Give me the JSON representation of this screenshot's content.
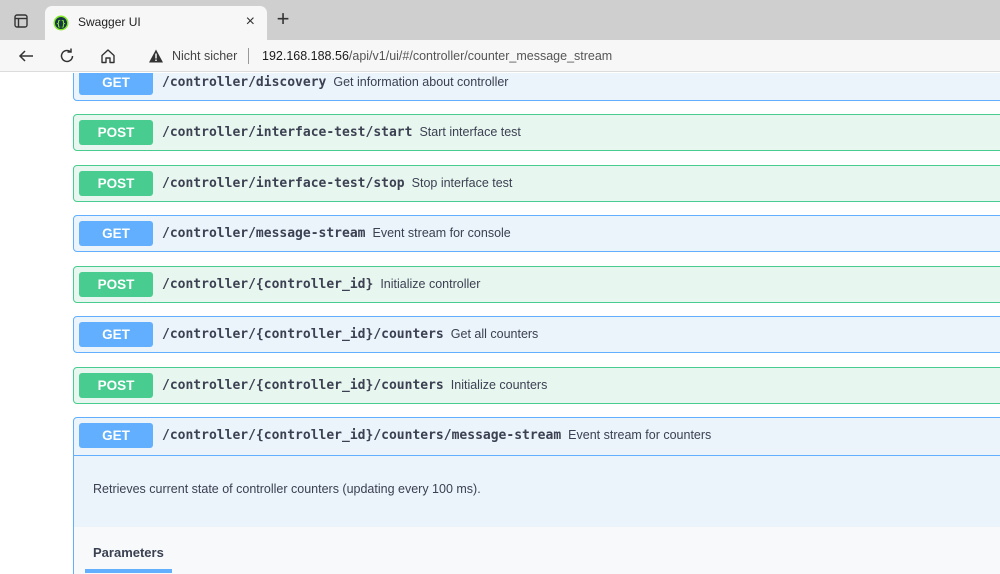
{
  "browser": {
    "tab_title": "Swagger UI",
    "tab_close": "×",
    "new_tab": "+",
    "security_status": "Nicht sicher",
    "url_host": "192.168.188.56",
    "url_path": "/api/v1/ui/#/controller/counter_message_stream",
    "icons": [
      "tab-actions-icon",
      "favicon-icon",
      "back-icon",
      "reload-icon",
      "home-icon",
      "warning-icon"
    ]
  },
  "colors": {
    "get": "#61affe",
    "post": "#49cc90",
    "get_bg": "#ebf3fb",
    "post_bg": "#e8f6f0"
  },
  "operations": [
    {
      "method": "GET",
      "path": "/controller/discovery",
      "summary": "Get information about controller"
    },
    {
      "method": "POST",
      "path": "/controller/interface-test/start",
      "summary": "Start interface test"
    },
    {
      "method": "POST",
      "path": "/controller/interface-test/stop",
      "summary": "Stop interface test"
    },
    {
      "method": "GET",
      "path": "/controller/message-stream",
      "summary": "Event stream for console"
    },
    {
      "method": "POST",
      "path": "/controller/{controller_id}",
      "summary": "Initialize controller"
    },
    {
      "method": "GET",
      "path": "/controller/{controller_id}/counters",
      "summary": "Get all counters"
    },
    {
      "method": "POST",
      "path": "/controller/{controller_id}/counters",
      "summary": "Initialize counters"
    }
  ],
  "expanded_op": {
    "method": "GET",
    "path": "/controller/{controller_id}/counters/message-stream",
    "summary": "Event stream for counters",
    "description": "Retrieves current state of controller counters (updating every 100 ms).",
    "parameters_tab": "Parameters"
  }
}
